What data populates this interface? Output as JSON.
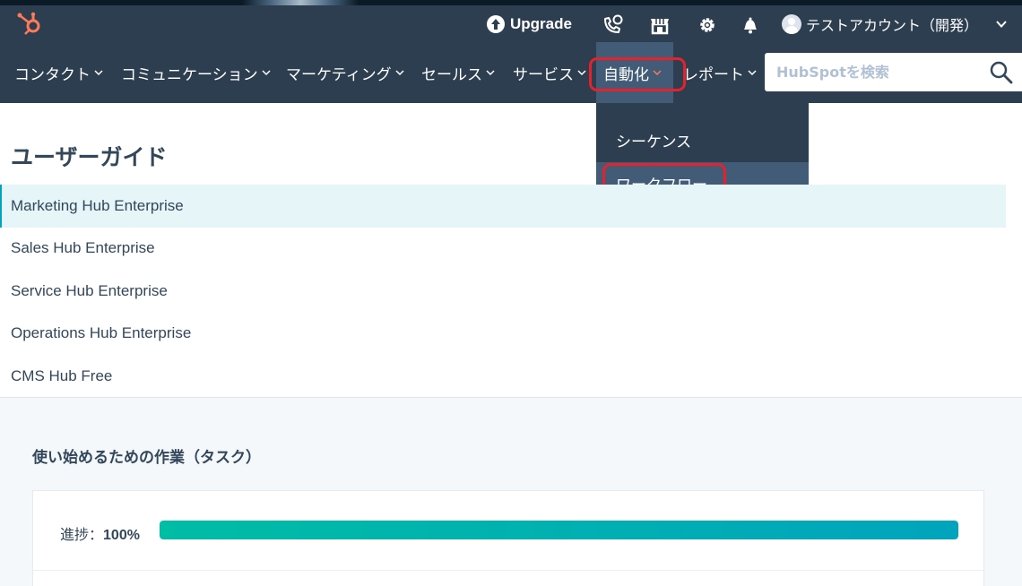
{
  "topbar": {
    "upgrade_label": "Upgrade",
    "account_name": "テストアカウント（開発）",
    "icons": [
      "hubspot-logo-icon",
      "upgrade-arrow-icon",
      "calling-icon",
      "marketplace-icon",
      "gear-icon",
      "bell-icon",
      "avatar",
      "chevron-down-icon"
    ]
  },
  "nav": {
    "items": [
      {
        "label": "コンタクト"
      },
      {
        "label": "コミュニケーション"
      },
      {
        "label": "マーケティング"
      },
      {
        "label": "セールス"
      },
      {
        "label": "サービス"
      },
      {
        "label": "自動化"
      },
      {
        "label": "レポート"
      }
    ],
    "active_index": 5,
    "search_placeholder": "HubSpotを検索"
  },
  "dropdown": {
    "items": [
      {
        "label": "シーケンス"
      },
      {
        "label": "ワークフロー"
      }
    ],
    "hover_index": 1
  },
  "guide": {
    "title": "ユーザーガイド",
    "items": [
      {
        "label": "Marketing Hub Enterprise"
      },
      {
        "label": "Sales Hub Enterprise"
      },
      {
        "label": "Service Hub Enterprise"
      },
      {
        "label": "Operations Hub Enterprise"
      },
      {
        "label": "CMS Hub Free"
      }
    ],
    "selected_index": 0
  },
  "tasks": {
    "title": "使い始めるための作業（タスク）",
    "progress_prefix": "進捗：",
    "progress_value": "100%",
    "progress_fraction": 1.0
  },
  "colors": {
    "nav_bg": "#2d3e50",
    "nav_active": "#425b76",
    "highlight_red": "#e4222e",
    "hubspot_orange": "#ff7a59",
    "progress_start": "#00bda5",
    "progress_end": "#00a4bd"
  }
}
